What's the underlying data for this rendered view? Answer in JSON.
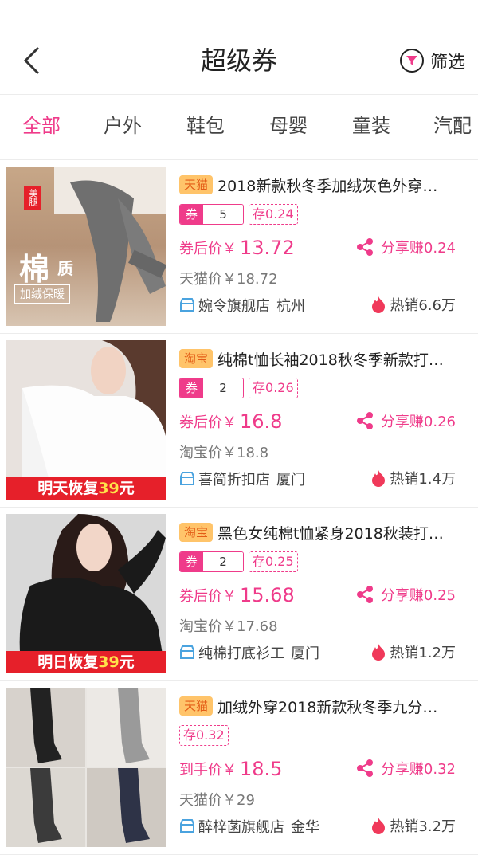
{
  "header": {
    "title": "超级券",
    "filter_label": "筛选"
  },
  "colors": {
    "accent": "#ef3b8a",
    "tmall_tag_bg": "#ffc46a",
    "banner_red": "#e6202a"
  },
  "tabs": [
    "全部",
    "户外",
    "鞋包",
    "母婴",
    "童装",
    "汽配"
  ],
  "active_tab": "全部",
  "products": [
    {
      "platform": "天猫",
      "title": "2018新款秋冬季加绒灰色外穿…",
      "coupon_label": "券",
      "coupon_value": "5",
      "cun": "存0.24",
      "price_label": "券后价￥",
      "price": "13.72",
      "share": "分享赚0.24",
      "orig_price": "天猫价￥18.72",
      "shop": "婉令旗舰店",
      "city": "杭州",
      "sales": "热销6.6万",
      "img_caption": "棉",
      "img_caption2": "质",
      "img_subcaption": "加绒保暖",
      "img_tag": "美腿"
    },
    {
      "platform": "淘宝",
      "title": "纯棉t恤长袖2018秋冬季新款打…",
      "coupon_label": "券",
      "coupon_value": "2",
      "cun": "存0.26",
      "price_label": "券后价￥",
      "price": "16.8",
      "share": "分享赚0.26",
      "orig_price": "淘宝价￥18.8",
      "shop": "喜简折扣店",
      "city": "厦门",
      "sales": "热销1.4万",
      "banner_pre": "明天恢复",
      "banner_num": "39",
      "banner_post": "元"
    },
    {
      "platform": "淘宝",
      "title": "黑色女纯棉t恤紧身2018秋装打…",
      "coupon_label": "券",
      "coupon_value": "2",
      "cun": "存0.25",
      "price_label": "券后价￥",
      "price": "15.68",
      "share": "分享赚0.25",
      "orig_price": "淘宝价￥17.68",
      "shop": "纯棉打底衫工",
      "city": "厦门",
      "sales": "热销1.2万",
      "banner_pre": "明日恢复",
      "banner_num": "39",
      "banner_post": "元"
    },
    {
      "platform": "天猫",
      "title": "加绒外穿2018新款秋冬季九分…",
      "cun": "存0.32",
      "price_label": "到手价￥",
      "price": "18.5",
      "share": "分享赚0.32",
      "orig_price": "天猫价￥29",
      "shop": "醉梓菡旗舰店",
      "city": "金华",
      "sales": "热销3.2万"
    }
  ]
}
